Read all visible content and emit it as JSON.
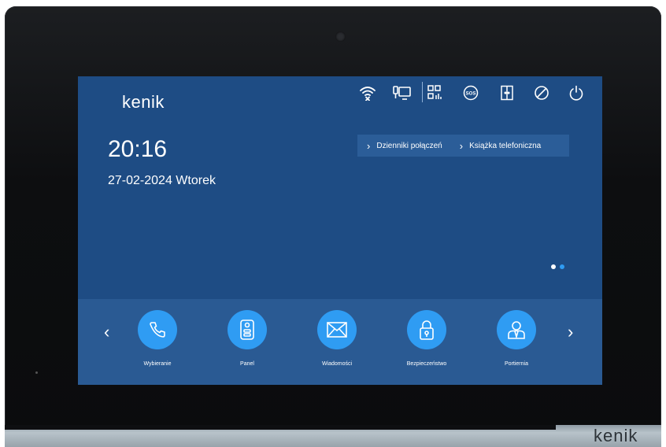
{
  "device": {
    "brand_logo": "kenik"
  },
  "screen": {
    "logo": "kenik",
    "time": "20:16",
    "date": "27-02-2024 Wtorek",
    "status_icons": [
      "wifi-off-icon",
      "intercom-icon",
      "qr-signal-icon",
      "sos-icon",
      "door-icon",
      "do-not-disturb-icon",
      "power-icon"
    ],
    "links": [
      {
        "label": "Dzienniki połączeń"
      },
      {
        "label": "Książka telefoniczna"
      }
    ],
    "page_indicator": {
      "current": 1,
      "total": 2
    },
    "nav": {
      "prev": "‹",
      "next": "›",
      "link_arrow": "›"
    },
    "apps": [
      {
        "label": "Wybieranie",
        "icon": "phone-icon"
      },
      {
        "label": "Panel",
        "icon": "door-station-icon"
      },
      {
        "label": "Wiadomości",
        "icon": "envelope-icon"
      },
      {
        "label": "Bezpieczeństwo",
        "icon": "lock-icon"
      },
      {
        "label": "Portiernia",
        "icon": "concierge-icon"
      }
    ],
    "colors": {
      "background": "#1e4c84",
      "bar": "#2a5a93",
      "accent": "#2f9cf3"
    }
  }
}
